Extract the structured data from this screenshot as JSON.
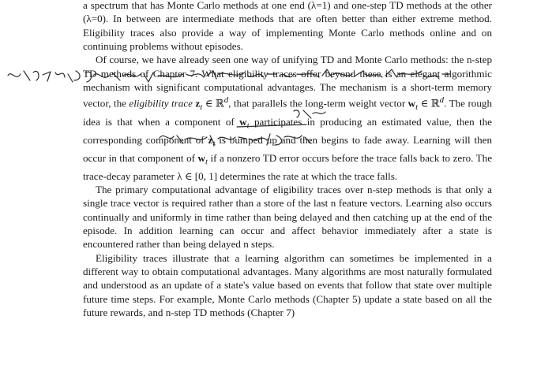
{
  "document": {
    "paragraph_0": "a spectrum that has Monte Carlo methods at one end (λ=1) and one-step TD methods at the other (λ=0). In between are intermediate methods that are often better than either extreme method. Eligibility traces also provide a way of implementing Monte Carlo methods online and on continuing problems without episodes.",
    "paragraph_1": {
      "part_a": "Of course, we have already seen one way of unifying TD and Monte Carlo methods: the n-step TD methods of Chapter 7. What eligibility traces offer beyond these is an elegant algorithmic mechanism with significant computational advantages. The mechanism is a short-term memory vector, the ",
      "term": "eligibility trace",
      "z_symbol": "z",
      "t_sub": "t",
      "in_rd_1": " ∈ ℝ",
      "d_sup": "d",
      "part_b": ", that parallels the long-term weight vector ",
      "w_symbol": "w",
      "in_rd_2": " ∈ ℝ",
      "part_c": ". The rough idea is that when a component of ",
      "part_d": " participates in producing an estimated value, then the corresponding component of ",
      "part_e": " is bumped up and then begins to fade away. Learning will then occur in that component of ",
      "part_f": " if a nonzero TD error occurs before the trace falls back to zero. The trace-decay parameter λ ∈ [0, 1] determines the rate at which the trace falls."
    },
    "paragraph_2": "The primary computational advantage of eligibility traces over n-step methods is that only a single trace vector is required rather than a store of the last n feature vectors. Learning also occurs continually and uniformly in time rather than being delayed and then catching up at the end of the episode. In addition learning can occur and affect behavior immediately after a state is encountered rather than being delayed n steps.",
    "paragraph_3": "Eligibility traces illustrate that a learning algorithm can sometimes be implemented in a different way to obtain computational advantages. Many algorithms are most naturally formulated and understood as an update of a state's value based on events that follow that state over multiple future time steps. For example, Monte Carlo methods (Chapter 5) update a state based on all the future rewards, and n-step TD methods (Chapter 7)"
  },
  "handwriting": {
    "line_1": "完善措施，强化推进，本方法为一笔做事也好的方法",
    "line_2": "以及目标的内容，积极成就",
    "note_short": "TD的"
  }
}
